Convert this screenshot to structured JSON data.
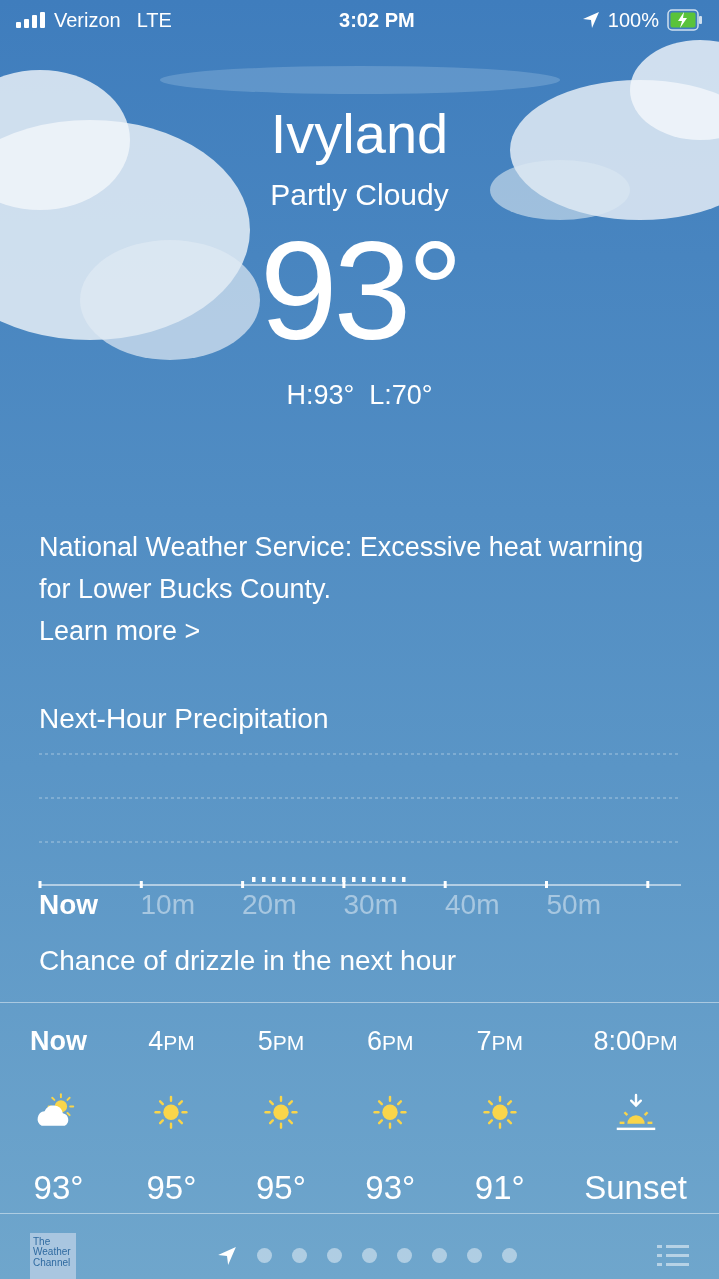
{
  "status_bar": {
    "carrier": "Verizon",
    "network": "LTE",
    "time": "3:02 PM",
    "battery": "100%",
    "charging": true,
    "location_active": true
  },
  "current": {
    "city": "Ivyland",
    "condition": "Partly Cloudy",
    "temperature": "93°",
    "high_low": "H:93°  L:70°"
  },
  "alert": {
    "text": "National Weather Service: Excessive heat warning for Lower Bucks County.",
    "link": "Learn more",
    "chevron": ">"
  },
  "precipitation": {
    "title": "Next-Hour Precipitation",
    "labels": [
      {
        "text": "Now",
        "selected": true
      },
      {
        "text": "10m",
        "selected": false
      },
      {
        "text": "20m",
        "selected": false
      },
      {
        "text": "30m",
        "selected": false
      },
      {
        "text": "40m",
        "selected": false
      },
      {
        "text": "50m",
        "selected": false
      }
    ],
    "summary": "Chance of drizzle in the next hour"
  },
  "hourly": [
    {
      "time": "Now",
      "kind": "partly-cloudy",
      "value": "93°"
    },
    {
      "time": "4",
      "suffix": "PM",
      "kind": "sun",
      "value": "95°"
    },
    {
      "time": "5",
      "suffix": "PM",
      "kind": "sun",
      "value": "95°"
    },
    {
      "time": "6",
      "suffix": "PM",
      "kind": "sun",
      "value": "93°"
    },
    {
      "time": "7",
      "suffix": "PM",
      "kind": "sun",
      "value": "91°"
    },
    {
      "time": "8:00",
      "suffix": "PM",
      "kind": "sunset",
      "value": "Sunset"
    }
  ],
  "bottom_bar": {
    "logo": "The Weather Channel",
    "pages": [
      {
        "kind": "location",
        "selected": true
      },
      {
        "kind": "dot",
        "selected": false
      },
      {
        "kind": "dot",
        "selected": false
      },
      {
        "kind": "dot",
        "selected": false
      },
      {
        "kind": "dot",
        "selected": false
      },
      {
        "kind": "dot",
        "selected": false
      },
      {
        "kind": "dot",
        "selected": false
      },
      {
        "kind": "dot",
        "selected": false
      },
      {
        "kind": "dot",
        "selected": false
      }
    ]
  }
}
